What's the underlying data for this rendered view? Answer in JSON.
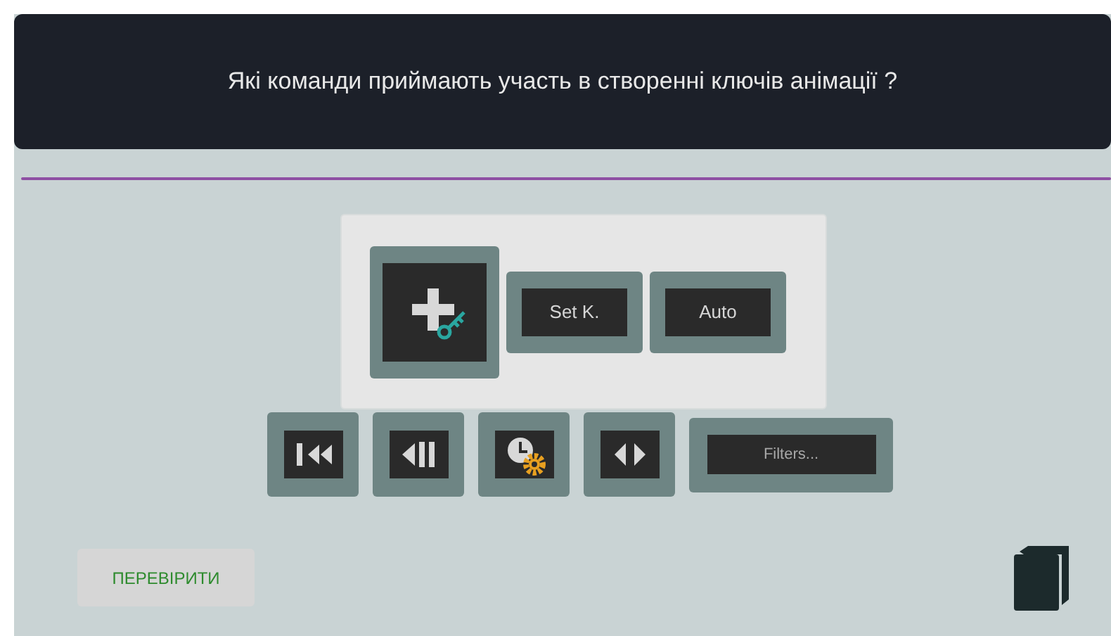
{
  "question": "Які команди приймають участь в створенні ключів анімації ?",
  "answer_area": {
    "items": [
      {
        "kind": "addkey"
      },
      {
        "kind": "text",
        "label": "Set K."
      },
      {
        "kind": "text",
        "label": "Auto"
      }
    ]
  },
  "choices": [
    {
      "kind": "tostart"
    },
    {
      "kind": "stepback"
    },
    {
      "kind": "clockgear"
    },
    {
      "kind": "arrows"
    },
    {
      "kind": "wide",
      "label": "Filters..."
    }
  ],
  "check_button": "ПЕРЕВІРИТИ"
}
